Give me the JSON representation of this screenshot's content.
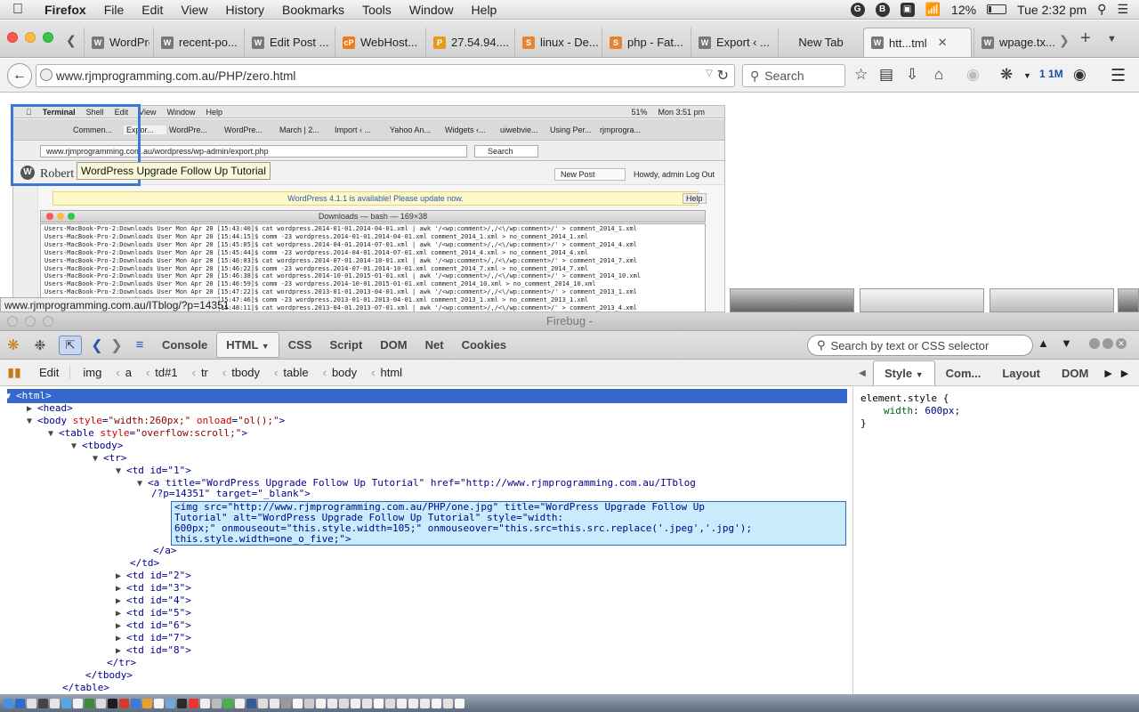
{
  "menubar": {
    "items": [
      "Firefox",
      "File",
      "Edit",
      "View",
      "History",
      "Bookmarks",
      "Tools",
      "Window",
      "Help"
    ],
    "battery": "12%",
    "clock": "Tue 2:32 pm"
  },
  "tabs": [
    {
      "label": "WordPre..."
    },
    {
      "label": "recent-po..."
    },
    {
      "label": "Edit Post ..."
    },
    {
      "label": "WebHost..."
    },
    {
      "label": "27.54.94...."
    },
    {
      "label": "linux - De..."
    },
    {
      "label": "php - Fat..."
    },
    {
      "label": "Export ‹ ..."
    },
    {
      "label": "New Tab"
    },
    {
      "label": "htt...tml"
    },
    {
      "label": "wpage.tx..."
    }
  ],
  "nav": {
    "url": "www.rjmprogramming.com.au/PHP/zero.html",
    "search_placeholder": "Search",
    "badge": "1M"
  },
  "embedded": {
    "menubar": [
      "Terminal",
      "Shell",
      "Edit",
      "View",
      "Window",
      "Help"
    ],
    "battery": "51%",
    "clock": "Mon 3:51 pm",
    "tabs": [
      "Commen...",
      "Expor...",
      "WordPre...",
      "WordPre...",
      "March | 2...",
      "Import ‹ ...",
      "Yahoo An...",
      "Widgets ‹...",
      "uiwebvie...",
      "Using Per...",
      "rjmprogra..."
    ],
    "url": "www.rjmprogramming.com.au/wordpress/wp-admin/export.php",
    "search": "Search",
    "blog_title": "Robert Metcalfe Blog",
    "new_post": "New Post",
    "howdy": "Howdy, admin",
    "logout": "Log Out",
    "update_notice": "WordPress 4.1.1 is available! Please update now.",
    "help": "Help",
    "terminal_title": "Downloads — bash — 169×38",
    "terminal_lines": [
      "Users-MacBook-Pro-2:Downloads User Mon Apr 20 [15:43:40]$ cat wordpress.2014-01-01.2014-04-01.xml | awk '/<wp:comment>/,/<\\/wp:comment>/' > comment_2014_1.xml",
      "Users-MacBook-Pro-2:Downloads User Mon Apr 20 [15:44:15]$ comm -23 wordpress.2014-01-01.2014-04-01.xml comment_2014_1.xml > no_comment_2014_1.xml",
      "Users-MacBook-Pro-2:Downloads User Mon Apr 20 [15:45:05]$ cat wordpress.2014-04-01.2014-07-01.xml | awk '/<wp:comment>/,/<\\/wp:comment>/' > comment_2014_4.xml",
      "Users-MacBook-Pro-2:Downloads User Mon Apr 20 [15:45:44]$ comm -23 wordpress.2014-04-01.2014-07-01.xml comment_2014_4.xml > no_comment_2014_4.xml",
      "Users-MacBook-Pro-2:Downloads User Mon Apr 20 [15:46:03]$ cat wordpress.2014-07-01.2014-10-01.xml | awk '/<wp:comment>/,/<\\/wp:comment>/' > comment_2014_7.xml",
      "Users-MacBook-Pro-2:Downloads User Mon Apr 20 [15:46:22]$ comm -23 wordpress.2014-07-01.2014-10-01.xml comment_2014_7.xml > no_comment_2014_7.xml",
      "Users-MacBook-Pro-2:Downloads User Mon Apr 20 [15:46:38]$ cat wordpress.2014-10-01.2015-01-01.xml | awk '/<wp:comment>/,/<\\/wp:comment>/' > comment_2014_10.xml",
      "Users-MacBook-Pro-2:Downloads User Mon Apr 20 [15:46:59]$ comm -23 wordpress.2014-10-01.2015-01-01.xml comment_2014_10.xml > no_comment_2014_10.xml",
      "Users-MacBook-Pro-2:Downloads User Mon Apr 20 [15:47:22]$ cat wordpress.2013-01-01.2013-04-01.xml | awk '/<wp:comment>/,/<\\/wp:comment>/' > comment_2013_1.xml",
      "Users-MacBook-Pro-2:Downloads User Mon Apr 20 [15:47:46]$ comm -23 wordpress.2013-01-01.2013-04-01.xml comment_2013_1.xml > no_comment_2013_1.xml",
      "Users-MacBook-Pro-2:Downloads User Mon Apr 20 [15:48:11]$ cat wordpress.2013-04-01.2013-07-01.xml | awk '/<wp:comment>/,/<\\/wp:comment>/' > comment_2013_4.xml"
    ],
    "tooltip": "WordPress Upgrade Follow Up Tutorial"
  },
  "status_url": "www.rjmprogramming.com.au/ITblog/?p=14351",
  "firebug": {
    "title": "Firebug -",
    "panels": [
      "Console",
      "HTML",
      "CSS",
      "Script",
      "DOM",
      "Net",
      "Cookies"
    ],
    "active_panel": "HTML",
    "search_placeholder": "Search by text or CSS selector",
    "edit_label": "Edit",
    "breadcrumbs": [
      "img",
      "a",
      "td#1",
      "tr",
      "tbody",
      "table",
      "body",
      "html"
    ],
    "side_tabs": [
      "Style",
      "Com...",
      "Layout",
      "DOM"
    ],
    "style_rule": {
      "selector": "element.style {",
      "prop": "width",
      "value": "600px;",
      "close": "}"
    }
  },
  "tree": {
    "html": "<html>",
    "head": "<head>",
    "body_tag": "body",
    "body_attr1": "style",
    "body_val1": "\"width:260px;\"",
    "body_attr2": "onload",
    "body_val2": "\"ol();\"",
    "table_tag": "table",
    "table_attr": "style",
    "table_val": "\"overflow:scroll;\"",
    "tbody": "<tbody>",
    "tr": "<tr>",
    "td_open": "<td id=\"1\">",
    "a_line1": "<a title=\"WordPress Upgrade Follow Up Tutorial\" href=\"http://www.rjmprogramming.com.au/ITblog",
    "a_line2": "/?p=14351\" target=\"_blank\">",
    "img_line1": "<img src=\"http://www.rjmprogramming.com.au/PHP/one.jpg\" title=\"WordPress Upgrade Follow Up",
    "img_line2": "Tutorial\" alt=\"WordPress Upgrade Follow Up Tutorial\" style=\"width:",
    "img_line3": "600px;\" onmouseout=\"this.style.width=105;\" onmouseover=\"this.src=this.src.replace('.jpeg','.jpg');",
    "img_line4": "this.style.width=one_o_five;\">",
    "a_close": "</a>",
    "td_close": "</td>",
    "td_rows": [
      "<td id=\"2\">",
      "<td id=\"3\">",
      "<td id=\"4\">",
      "<td id=\"5\">",
      "<td id=\"6\">",
      "<td id=\"7\">",
      "<td id=\"8\">"
    ],
    "tr_close": "</tr>",
    "tbody_close": "</tbody>",
    "table_close": "</table>"
  }
}
